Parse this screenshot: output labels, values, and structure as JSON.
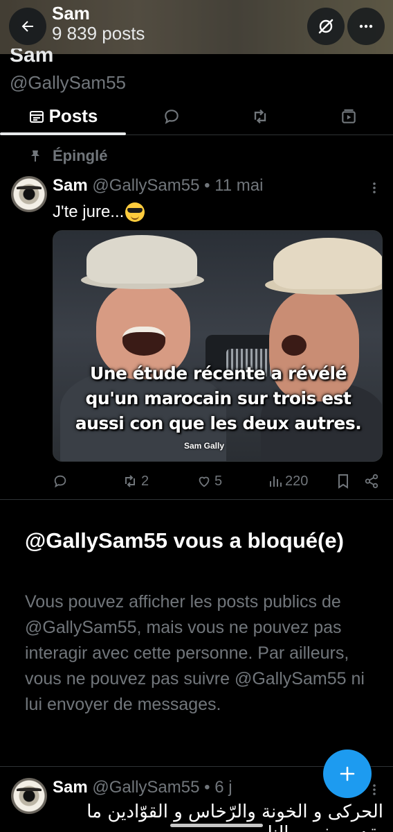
{
  "header": {
    "name": "Sam",
    "post_count": "9 839 posts"
  },
  "profile": {
    "name": "Sam",
    "handle": "@GallySam55"
  },
  "tabs": [
    {
      "label": "Posts",
      "icon": "posts-icon",
      "selected": true
    },
    {
      "label": "",
      "icon": "reply-icon"
    },
    {
      "label": "",
      "icon": "repost-icon"
    },
    {
      "label": "",
      "icon": "media-icon"
    }
  ],
  "pinned_post": {
    "pinned_label": "Épinglé",
    "author_name": "Sam",
    "author_handle": "@GallySam55",
    "separator": "•",
    "date": "11 mai",
    "text": "J'te jure...",
    "emoji": "smiling-face-with-sunglasses",
    "image": {
      "caption_lines": [
        "Une étude récente a révélé",
        "qu'un marocain sur trois est",
        "aussi con que les deux autres."
      ],
      "signature": "Sam Gally"
    },
    "actions": {
      "replies": "",
      "reposts": "2",
      "likes": "5",
      "views": "220"
    }
  },
  "blocked_notice": {
    "title": "@GallySam55 vous a bloqué(e)",
    "body": "Vous pouvez afficher les posts publics de @GallySam55, mais vous ne pouvez pas interagir avec cette personne. Par ailleurs, vous ne pouvez pas suivre @GallySam55 ni lui envoyer de messages."
  },
  "next_post": {
    "author_name": "Sam",
    "author_handle": "@GallySam55",
    "separator": "•",
    "date": "6 j",
    "text_line1": "الحركى و الخونة والرّخاس و القوّادين ما",
    "text_line2": "يقدرو يفهمو الناس"
  },
  "colors": {
    "background": "#000000",
    "accent": "#1d9bf0",
    "muted_text": "#71767b",
    "divider": "#2f3336"
  }
}
